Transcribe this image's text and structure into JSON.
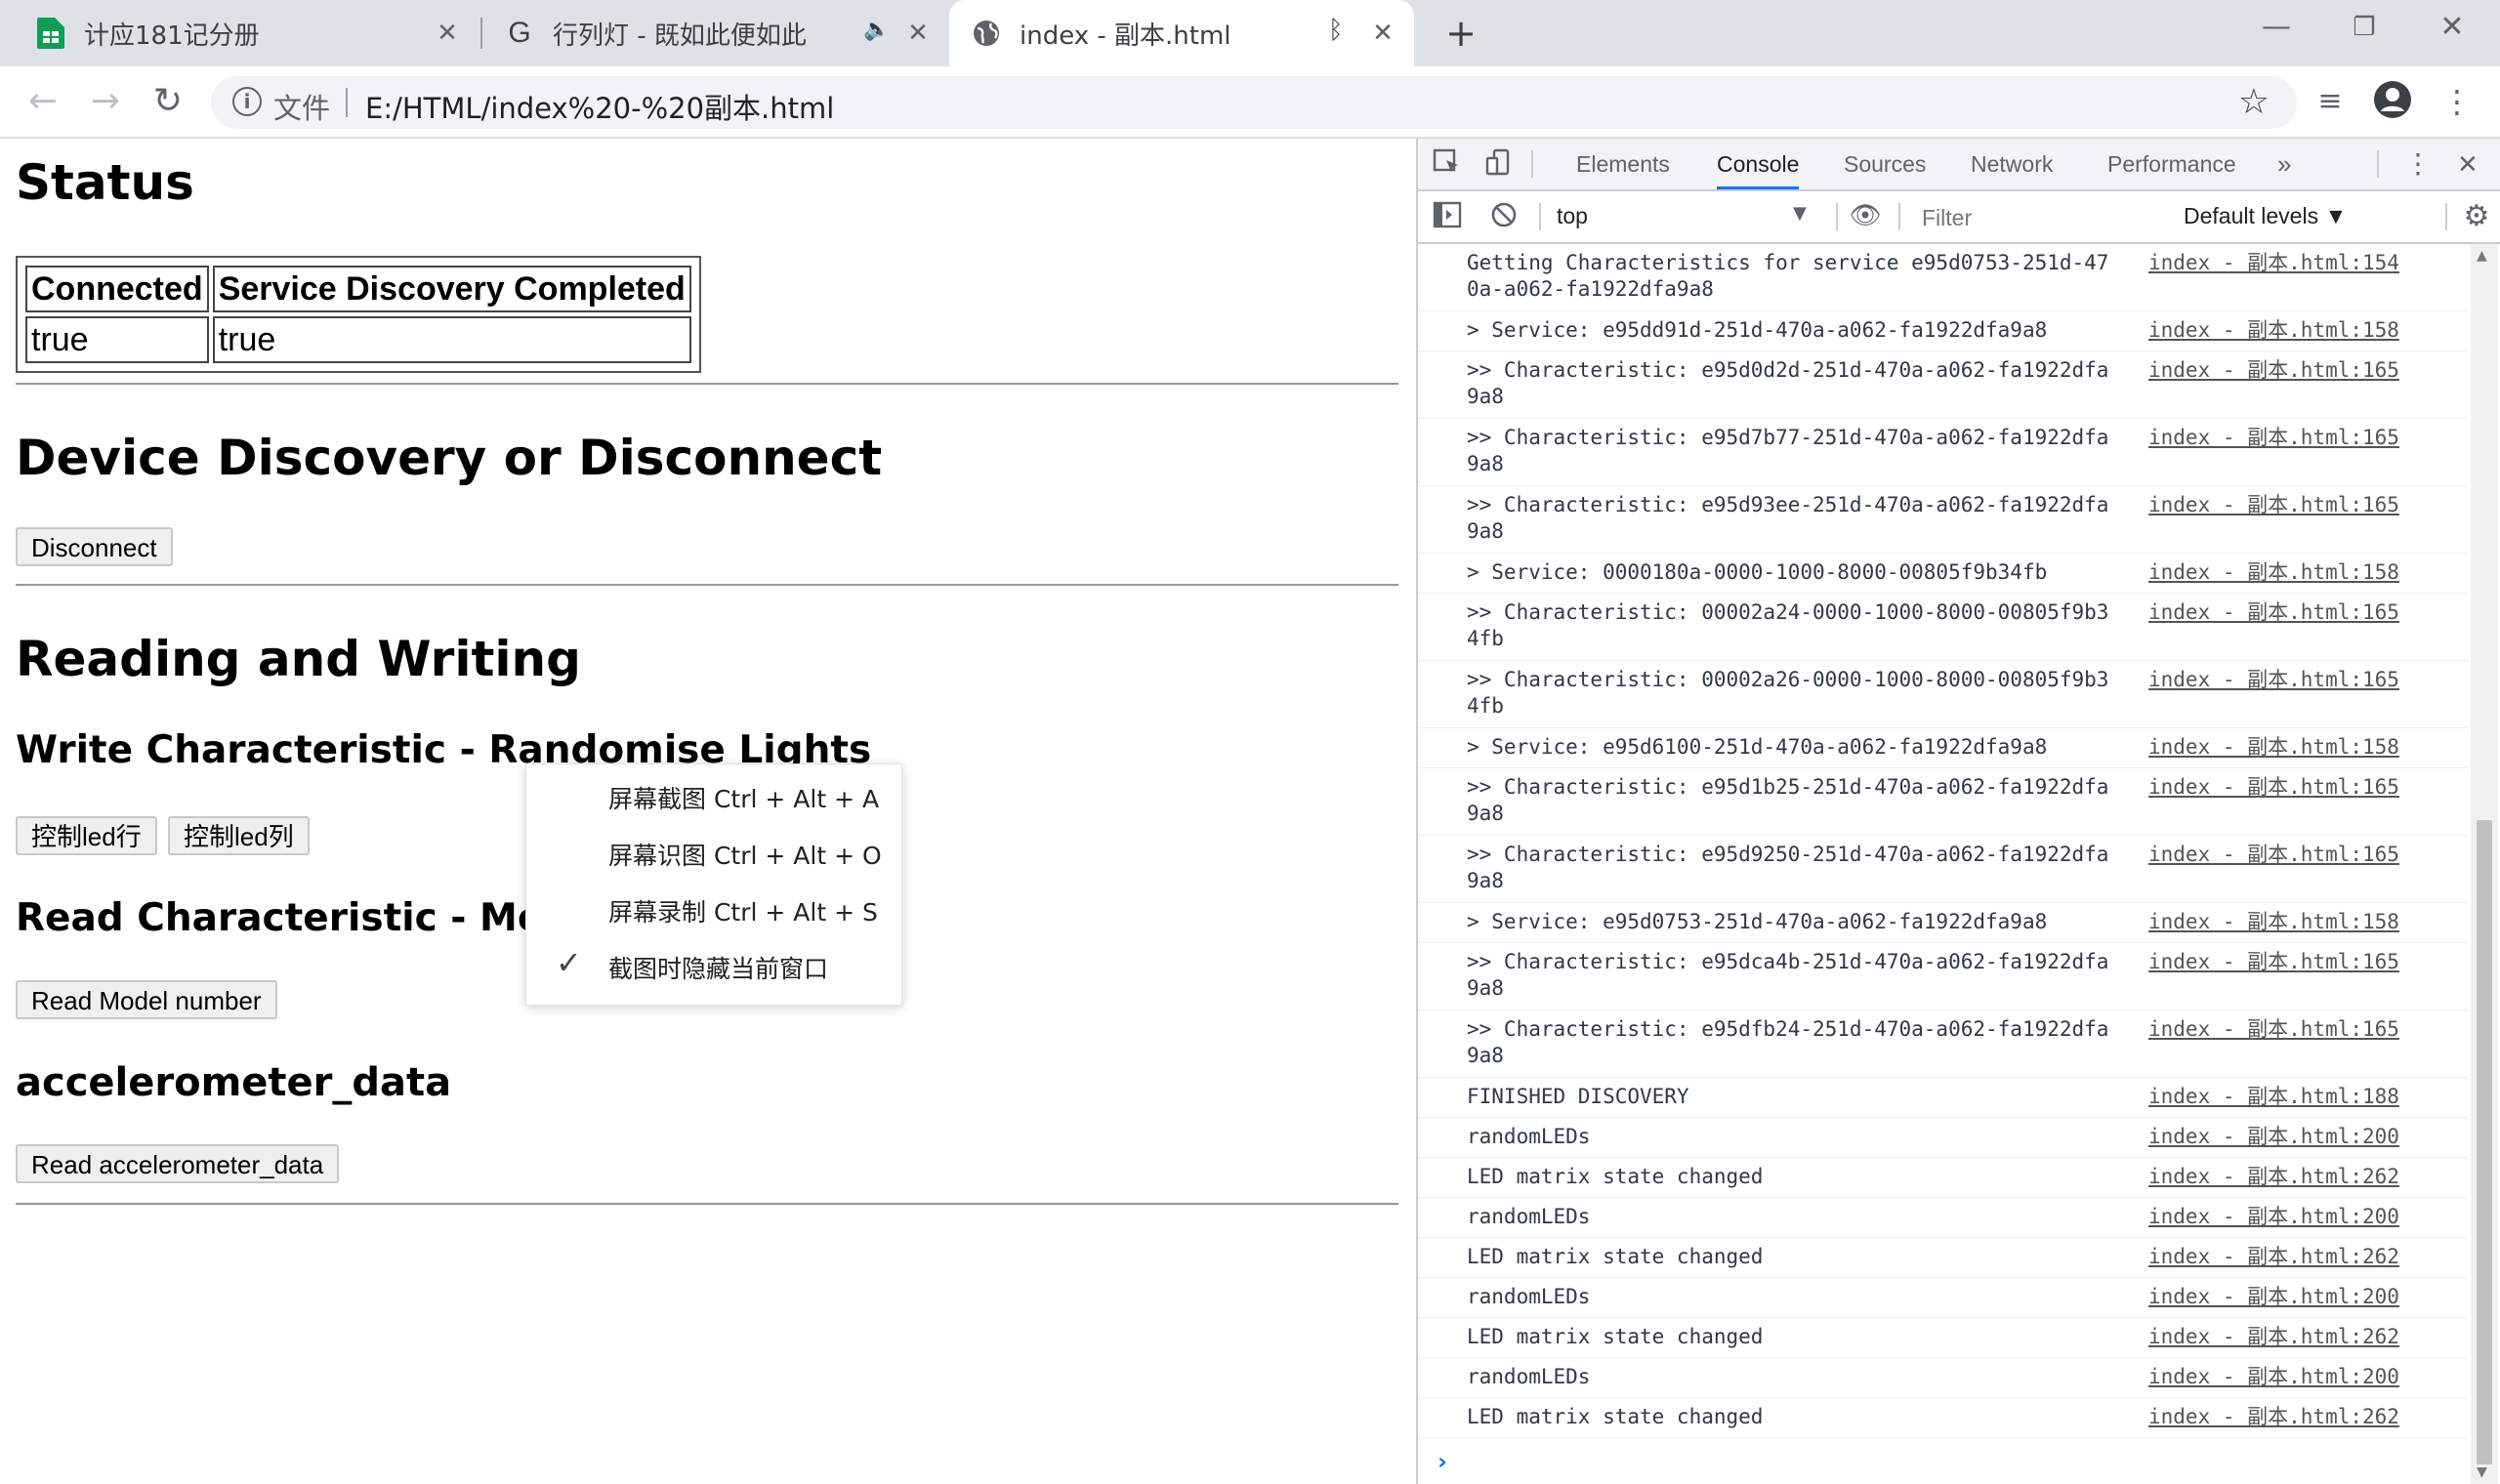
{
  "tabs": [
    {
      "title": "计应181记分册",
      "icon": "sheets-icon"
    },
    {
      "title": "行列灯 - 既如此便如此",
      "icon": "g-icon",
      "audio": true
    },
    {
      "title": "index - 副本.html",
      "icon": "globe-icon",
      "bluetooth": true
    }
  ],
  "address": {
    "scheme": "文件",
    "url": "E:/HTML/index%20-%20副本.html"
  },
  "page": {
    "status_heading": "Status",
    "status_table": {
      "headers": [
        "Connected",
        "Service Discovery Completed"
      ],
      "values": [
        "true",
        "true"
      ]
    },
    "discovery_heading": "Device Discovery or Disconnect",
    "disconnect_button": "Disconnect",
    "rw_heading": "Reading and Writing",
    "write_heading": "Write Characteristic - Randomise Lights",
    "led_row_button": "控制led行",
    "led_col_button": "控制led列",
    "read_heading": "Read Characteristic - Model number",
    "read_model_button": "Read Model number",
    "accel_heading": "accelerometer_data",
    "read_accel_button": "Read accelerometer_data"
  },
  "context_menu": {
    "items": [
      {
        "label": "屏幕截图 Ctrl + Alt + A",
        "checked": false
      },
      {
        "label": "屏幕识图 Ctrl + Alt + O",
        "checked": false
      },
      {
        "label": "屏幕录制 Ctrl + Alt + S",
        "checked": false
      },
      {
        "label": "截图时隐藏当前窗口",
        "checked": true
      }
    ]
  },
  "devtools": {
    "tabs": [
      "Elements",
      "Console",
      "Sources",
      "Network",
      "Performance"
    ],
    "active_tab": "Console",
    "context": "top",
    "filter_placeholder": "Filter",
    "levels": "Default levels ▼",
    "messages": [
      {
        "text": "Getting Characteristics for service e95d0753-251d-470a-a062-fa1922dfa9a8",
        "src": "index - 副本.html:154",
        "lines": 2
      },
      {
        "text": "> Service: e95dd91d-251d-470a-a062-fa1922dfa9a8",
        "src": "index - 副本.html:158",
        "lines": 1
      },
      {
        "text": ">> Characteristic: e95d0d2d-251d-470a-a062-fa1922dfa9a8",
        "src": "index - 副本.html:165",
        "lines": 2
      },
      {
        "text": ">> Characteristic: e95d7b77-251d-470a-a062-fa1922dfa9a8",
        "src": "index - 副本.html:165",
        "lines": 2
      },
      {
        "text": ">> Characteristic: e95d93ee-251d-470a-a062-fa1922dfa9a8",
        "src": "index - 副本.html:165",
        "lines": 2
      },
      {
        "text": "> Service: 0000180a-0000-1000-8000-00805f9b34fb",
        "src": "index - 副本.html:158",
        "lines": 1
      },
      {
        "text": ">> Characteristic: 00002a24-0000-1000-8000-00805f9b34fb",
        "src": "index - 副本.html:165",
        "lines": 2
      },
      {
        "text": ">> Characteristic: 00002a26-0000-1000-8000-00805f9b34fb",
        "src": "index - 副本.html:165",
        "lines": 2
      },
      {
        "text": "> Service: e95d6100-251d-470a-a062-fa1922dfa9a8",
        "src": "index - 副本.html:158",
        "lines": 1
      },
      {
        "text": ">> Characteristic: e95d1b25-251d-470a-a062-fa1922dfa9a8",
        "src": "index - 副本.html:165",
        "lines": 2
      },
      {
        "text": ">> Characteristic: e95d9250-251d-470a-a062-fa1922dfa9a8",
        "src": "index - 副本.html:165",
        "lines": 2
      },
      {
        "text": "> Service: e95d0753-251d-470a-a062-fa1922dfa9a8",
        "src": "index - 副本.html:158",
        "lines": 1
      },
      {
        "text": ">> Characteristic: e95dca4b-251d-470a-a062-fa1922dfa9a8",
        "src": "index - 副本.html:165",
        "lines": 2
      },
      {
        "text": ">> Characteristic: e95dfb24-251d-470a-a062-fa1922dfa9a8",
        "src": "index - 副本.html:165",
        "lines": 2
      },
      {
        "text": "FINISHED DISCOVERY",
        "src": "index - 副本.html:188",
        "lines": 1
      },
      {
        "text": "randomLEDs",
        "src": "index - 副本.html:200",
        "lines": 1
      },
      {
        "text": "LED matrix state changed",
        "src": "index - 副本.html:262",
        "lines": 1
      },
      {
        "text": "randomLEDs",
        "src": "index - 副本.html:200",
        "lines": 1
      },
      {
        "text": "LED matrix state changed",
        "src": "index - 副本.html:262",
        "lines": 1
      },
      {
        "text": "randomLEDs",
        "src": "index - 副本.html:200",
        "lines": 1
      },
      {
        "text": "LED matrix state changed",
        "src": "index - 副本.html:262",
        "lines": 1
      },
      {
        "text": "randomLEDs",
        "src": "index - 副本.html:200",
        "lines": 1
      },
      {
        "text": "LED matrix state changed",
        "src": "index - 副本.html:262",
        "lines": 1
      }
    ]
  },
  "colors": {
    "accent": "#1a73e8",
    "sheets_green": "#0f9d58",
    "tabstrip": "#dee1e6"
  }
}
